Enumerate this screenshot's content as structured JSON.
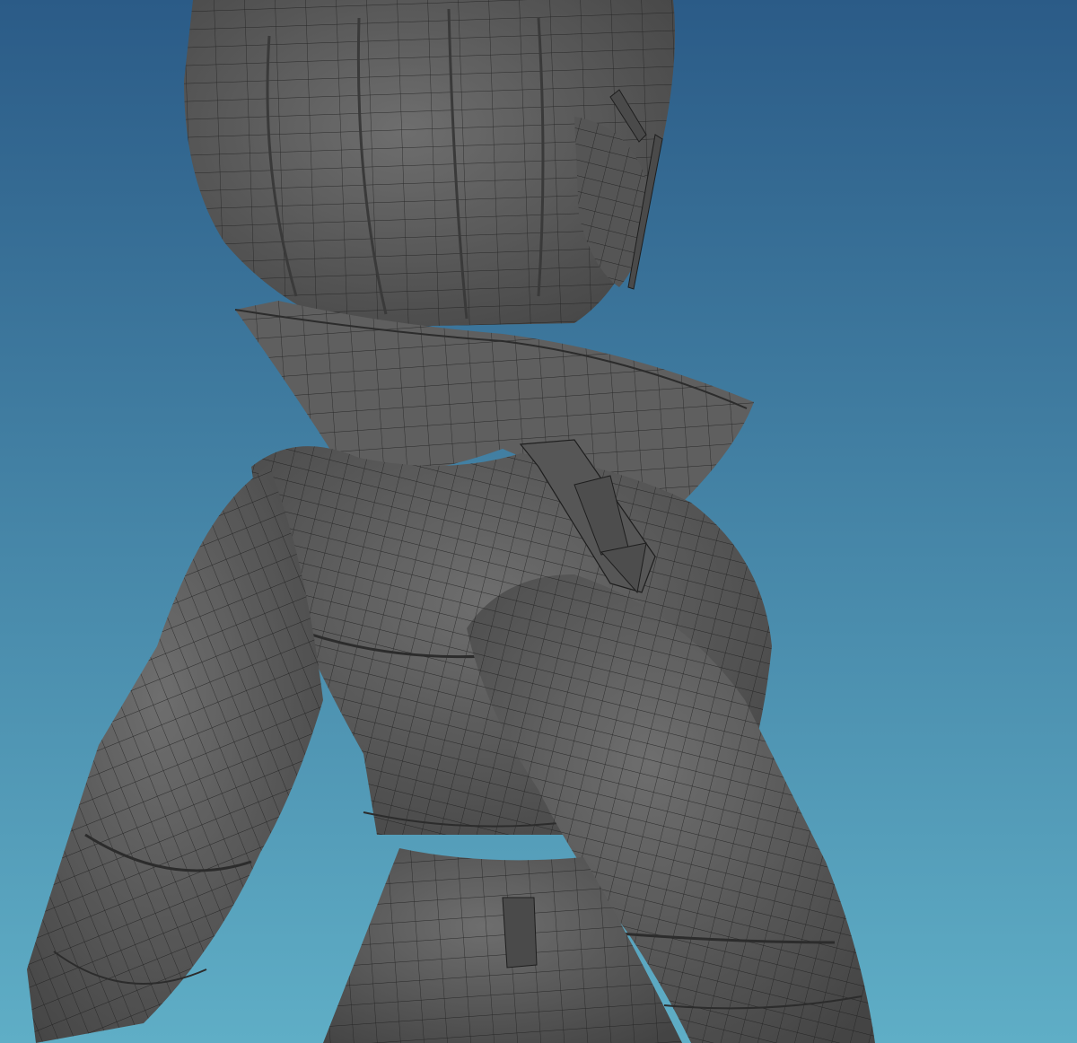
{
  "viewport": {
    "background_top": "#2b5b87",
    "background_bottom": "#5faec6",
    "mesh_color": "#5a5a5a",
    "mesh_shadow": "#3e3e3e",
    "mesh_highlight": "#6e6e6e",
    "wire_color": "#1e1e1e"
  }
}
